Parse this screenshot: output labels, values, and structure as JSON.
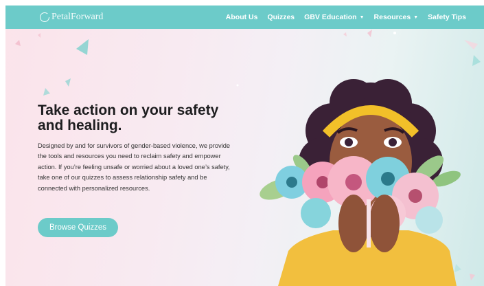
{
  "nav": {
    "logo": "PetalForward",
    "items": [
      {
        "label": "About Us",
        "has_dropdown": false
      },
      {
        "label": "Quizzes",
        "has_dropdown": false
      },
      {
        "label": "GBV Education",
        "has_dropdown": true
      },
      {
        "label": "Resources",
        "has_dropdown": true
      },
      {
        "label": "Safety Tips",
        "has_dropdown": false
      }
    ],
    "dropdown_icon": "chevron-down-icon",
    "background_color": "#6ccbc9"
  },
  "hero": {
    "title": "Take action on your safety and healing.",
    "description": "Designed by and for survivors of gender-based violence, we provide the tools and resources you need to reclaim safety and empower action.  If you’re feeling unsafe or worried about a loved one’s safety, take one of our quizzes to assess relationship safety and be connected with personalized resources.",
    "cta_label": "Browse Quizzes",
    "accent_color": "#6ccbc9",
    "illustration": "woman-with-flowers-illustration"
  }
}
